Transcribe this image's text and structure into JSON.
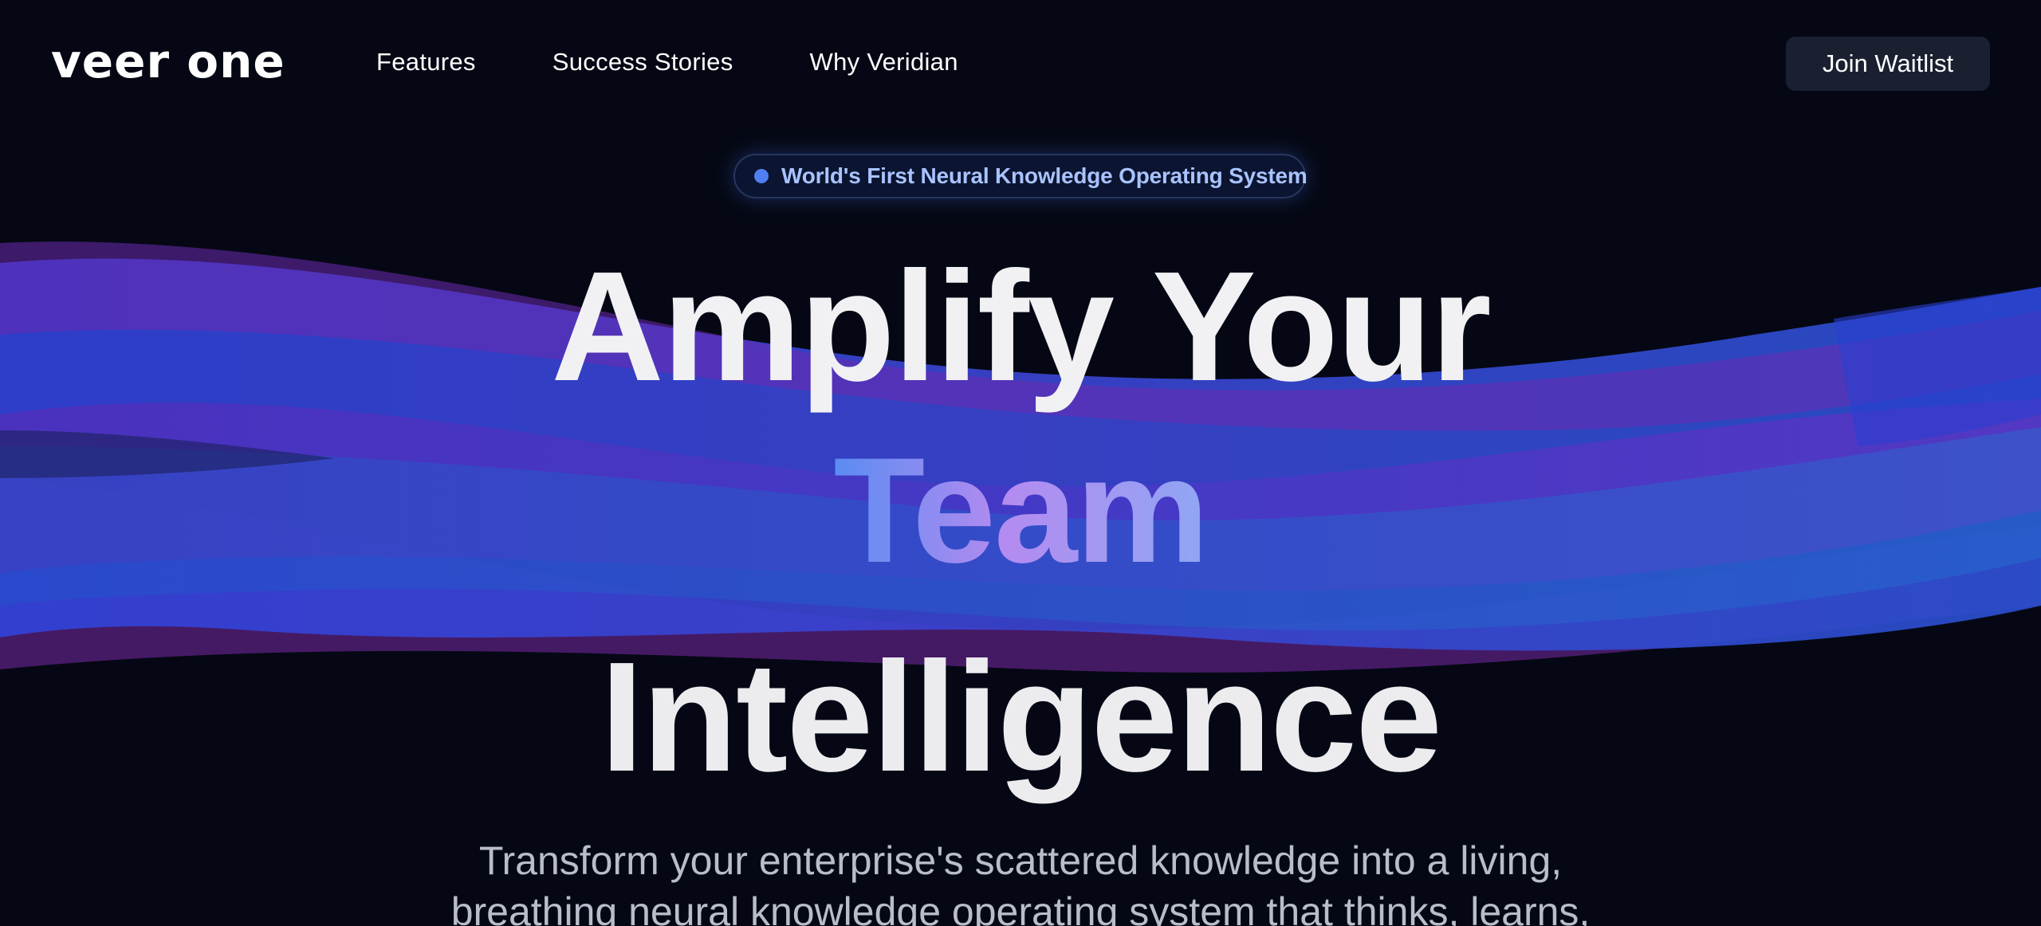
{
  "nav": {
    "logo": "veer one",
    "links": [
      "Features",
      "Success Stories",
      "Why Veridian"
    ],
    "cta_label": "Join Waitlist"
  },
  "badge": {
    "text": "World's First Neural Knowledge Operating System"
  },
  "hero": {
    "line1": "Amplify Your",
    "line2": "Team",
    "line3": "Intelligence",
    "subtitle_line1": "Transform your enterprise's scattered knowledge into a living,",
    "subtitle_line2": "breathing neural knowledge operating system that thinks, learns,"
  },
  "colors": {
    "background": "#050814",
    "wave_blue": "#2f49d6",
    "wave_violet": "#6a2fc4",
    "wave_magenta": "#7a2aa8",
    "badge_text": "#a9c3ff",
    "button_bg": "#1b2030"
  }
}
